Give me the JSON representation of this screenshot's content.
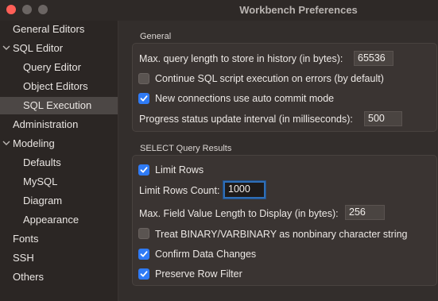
{
  "window": {
    "title": "Workbench Preferences"
  },
  "sidebar": {
    "items": [
      {
        "label": "General Editors"
      },
      {
        "label": "SQL Editor"
      },
      {
        "label": "Query Editor"
      },
      {
        "label": "Object Editors"
      },
      {
        "label": "SQL Execution"
      },
      {
        "label": "Administration"
      },
      {
        "label": "Modeling"
      },
      {
        "label": "Defaults"
      },
      {
        "label": "MySQL"
      },
      {
        "label": "Diagram"
      },
      {
        "label": "Appearance"
      },
      {
        "label": "Fonts"
      },
      {
        "label": "SSH"
      },
      {
        "label": "Others"
      }
    ],
    "selected": "SQL Execution"
  },
  "general": {
    "title": "General",
    "max_query_label": "Max. query length to store in history (in bytes):",
    "max_query_value": "65536",
    "continue_label": "Continue SQL script execution on errors (by default)",
    "continue_checked": false,
    "autocommit_label": "New connections use auto commit mode",
    "autocommit_checked": true,
    "progress_label": "Progress status update interval (in milliseconds):",
    "progress_value": "500"
  },
  "select": {
    "title": "SELECT Query Results",
    "limit_rows_label": "Limit Rows",
    "limit_rows_checked": true,
    "limit_count_label": "Limit Rows Count:",
    "limit_count_value": "1000",
    "max_field_label": "Max. Field Value Length to Display (in bytes):",
    "max_field_value": "256",
    "binary_label": "Treat BINARY/VARBINARY as nonbinary character string",
    "binary_checked": false,
    "confirm_label": "Confirm Data Changes",
    "confirm_checked": true,
    "preserve_label": "Preserve Row Filter",
    "preserve_checked": true
  }
}
